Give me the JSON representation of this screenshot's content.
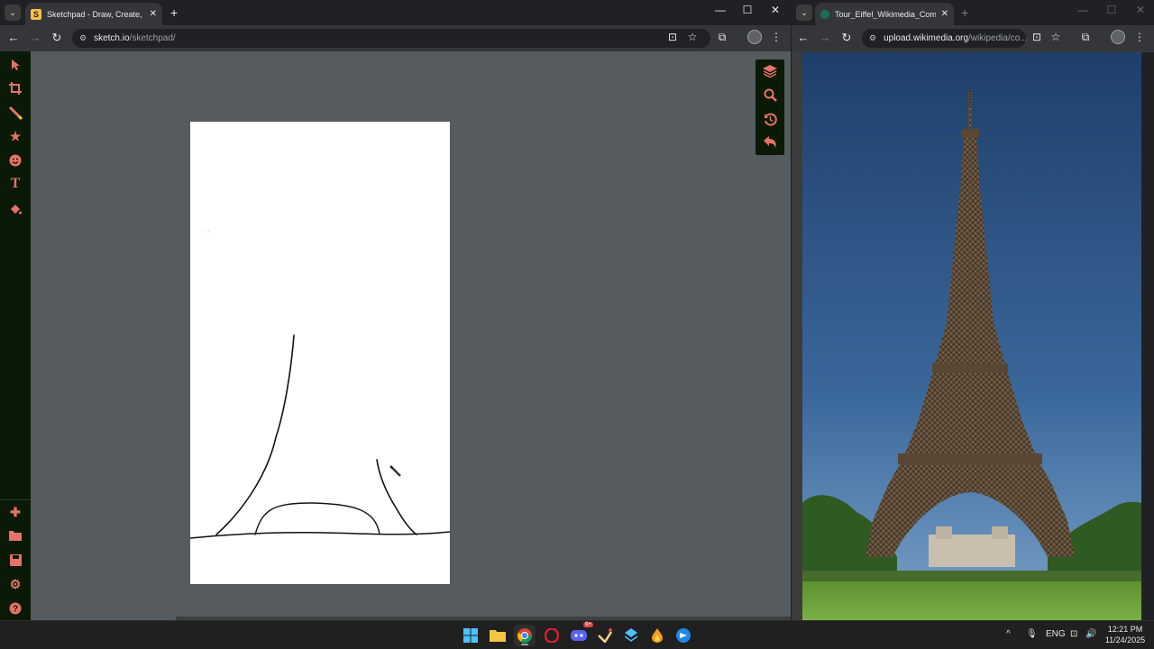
{
  "left_window": {
    "tab": {
      "title": "Sketchpad - Draw, Create, Share",
      "favicon": "S"
    },
    "url": {
      "host": "sketch.io",
      "path": "/sketchpad/"
    }
  },
  "right_window": {
    "tab": {
      "title": "Tour_Eiffel_Wikimedia_Commons"
    },
    "url": {
      "host": "upload.wikimedia.org",
      "path": "/wikipedia/co..."
    }
  },
  "sketchpad": {
    "tools": [
      "select-icon",
      "crop-icon",
      "brush-icon",
      "star-icon",
      "emoji-icon",
      "text-icon",
      "fill-icon"
    ],
    "text_tool_label": "T",
    "bottom_tools": [
      "add-icon",
      "folder-icon",
      "save-icon",
      "settings-icon",
      "help-icon"
    ],
    "dock": [
      "layers-icon",
      "zoom-icon",
      "history-icon",
      "undo-icon"
    ],
    "accent": "#e57368"
  },
  "taskbar": {
    "apps": [
      "windows-start-icon",
      "file-explorer-icon",
      "chrome-icon",
      "opera-icon",
      "discord-icon",
      "app-icon",
      "app-icon",
      "app-icon",
      "app-icon"
    ],
    "discord_badge": "9+",
    "language": "ENG",
    "time": "12:21 PM",
    "date": "11/24/2025"
  }
}
